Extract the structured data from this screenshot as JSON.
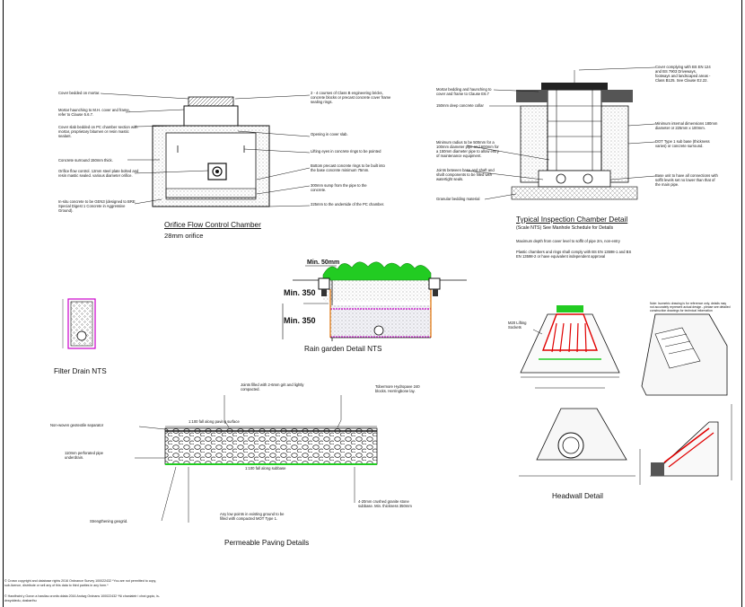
{
  "orifice": {
    "title": "Orifice Flow Control Chamber",
    "subtitle": "28mm orifice",
    "labels": {
      "cover_bedded": "Cover bedded on mortar.",
      "mortar_haunching": "Mortar haunching to M.H. cover and frame, refer to Clause 5.6.7.",
      "cover_slab": "Cover slab bedded on PC chamber section with mortar, proprietary bitumen or resin mastic sealant.",
      "concrete_surround": "Concrete surround 150mm thick.",
      "orifice_control": "Orifice flow control. 12mm steel plate bolted and resin mastic sealed. various diameter orifice.",
      "in_situ": "In-situ concrete to be GEN3 (designed to BRE Special Digest 1 Concrete in Aggressive Ground).",
      "courses_brick": "2 - 4 courses of Class B engineering bricks, concrete blocks or precast concrete cover frame sealing rings.",
      "opening": "Opening in cover slab.",
      "lifting_eyes": "Lifting eyes in concrete rings to be pointed",
      "bottom_precast": "Bottom precast concrete rings to be built into the base concrete minimum 75mm.",
      "sump": "300mm sump from the pipe to the concrete.",
      "underside": "225mm to the underside of the PC chamber."
    }
  },
  "inspection": {
    "title": "Typical Inspection Chamber Detail",
    "subtitle": "(Scale NTS) See Manhole Schedule for Details",
    "labels": {
      "cover_complying": "Cover complying with BS EN 124 and BS 7903 Driveways, footways and landscaped areas - Class B125. See Clause E2.22.",
      "mortar_bedding": "Mortar bedding and haunching to cover and frame to Clause E6.7",
      "deep_collar": "150mm deep concrete collar",
      "min_internal": "Minimum internal dimensions 180mm diameter or 225mm x 100mm.",
      "dot_type": "DOT Type 1 sub base (thickness varies) or concrete surround.",
      "min_radius": "Minimum radius to be 500mm for a 100mm diameter pipe and 600mm for a 150mm diameter pipe to allow entry of maintenance equipment.",
      "joints": "Joints between base and shaft and shaft components to be filled with watertight seals.",
      "base_unit": "Base unit to have all connections with soffit levels set no lower than that of the main pipe.",
      "granular": "Granular bedding material",
      "max_depth": "Maximum depth from cover level to soffit of pipe 2m, non-entry",
      "plastic": "Plastic chambers and rings shall comply with BS EN 13598-1 and BS EN 13598-2 or have equivalent independent approval"
    }
  },
  "rain_garden": {
    "title": "Rain garden Detail NTS",
    "dims": {
      "min50": "Min. 50mm",
      "min350a": "Min. 350",
      "min350b": "Min. 350"
    }
  },
  "filter_drain": {
    "title": "Filter Drain NTS"
  },
  "paving": {
    "title": "Permeable Paving Details",
    "labels": {
      "joints_filled": "Joints filled with 2-6mm grit and lightly compacted.",
      "tobermore": "Tobermore Hydropave 240 blocks. Herringbone lay.",
      "geotextile": "Non-woven geotextile separator",
      "fall_surface": "1:100 fall along paving surface",
      "perforated": "110mm perforated pipe underdrain.",
      "fall_subbase": "1:100 fall along subbase",
      "granite": "4-20mm crushed granite stone subbase. Min. thickness 350mm",
      "low_points": "Any low points in existing ground to be filled with compacted MOT Type 1.",
      "geogrid": "Strengthening geogrid."
    }
  },
  "headwall": {
    "title": "Headwall Detail",
    "m20": "M20 Lifting Sockets",
    "note": "Note: Isometric drawing is for reference only, details may not accurately represent actual design - please see detailed construction drawings for technical information"
  },
  "copyright": {
    "en": "© Crown copyright and database rights 2016 Ordnance Survey 100022432 *You are not permitted to copy, sub-licence, distribute or sell any of this data to third parties in any form.*",
    "cy": "© Hawlfraint y Goron a hawliau cronfa ddata 2016 Arolwg Ordnans 100022432 *Ni chaniateir i chwi gopio, is-drwyddedu, dosbarthu"
  },
  "colors": {
    "grass": "#22cc22",
    "magenta": "#cc00cc",
    "red": "#e00000",
    "orange": "#e07000"
  }
}
